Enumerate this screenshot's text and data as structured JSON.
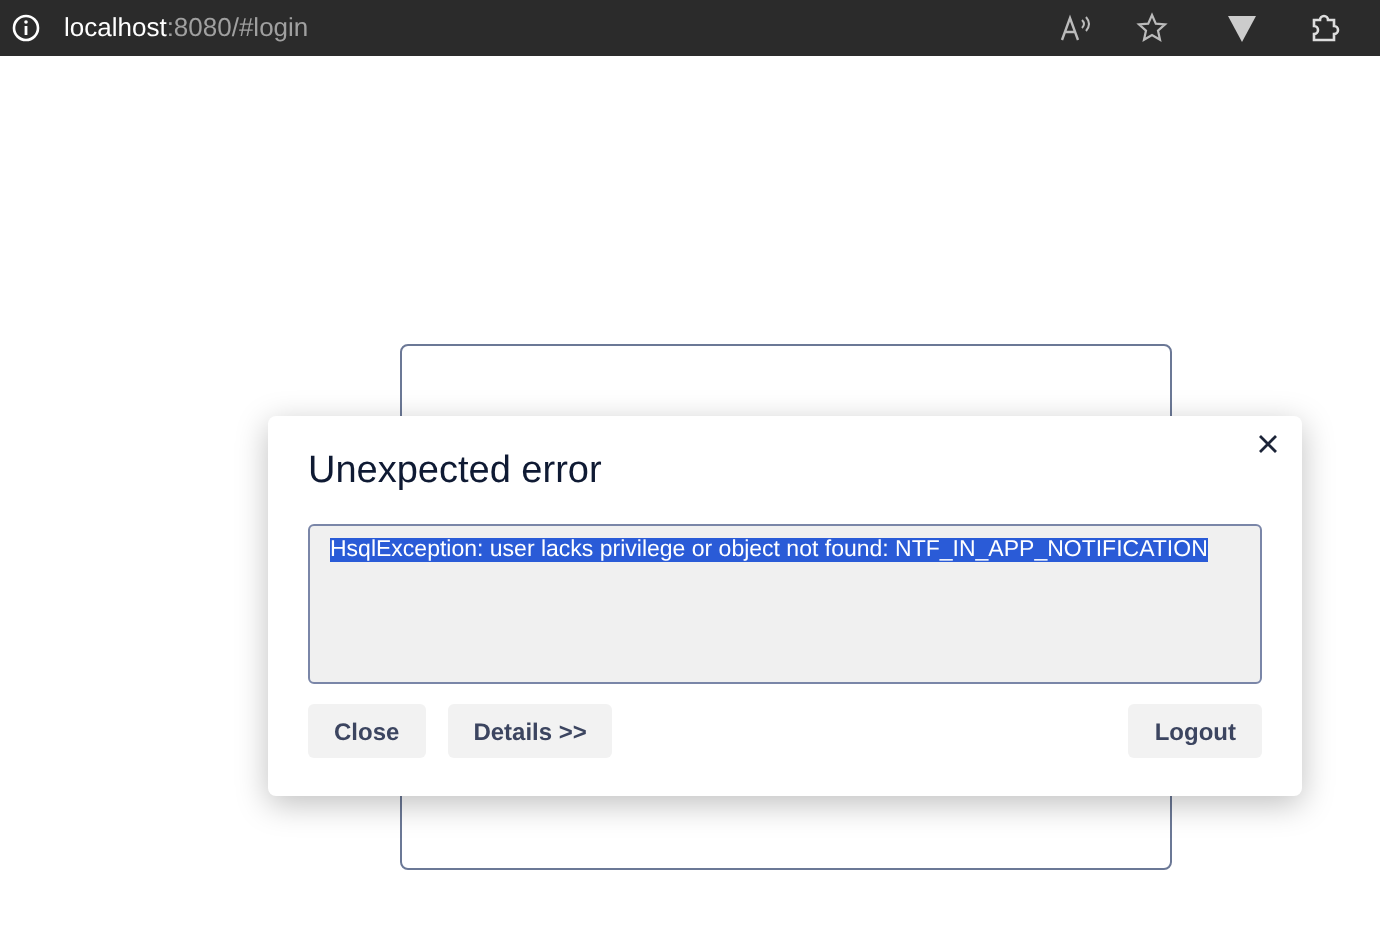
{
  "browser": {
    "address_host": "localhost",
    "address_rest": ":8080/#login"
  },
  "dialog": {
    "title": "Unexpected error",
    "message": {
      "text": "HsqlException: user lacks privilege or object not found: NTF_IN_APP_NOTIFICATION",
      "selected": true
    },
    "buttons_left": [
      {
        "label": "Close"
      },
      {
        "label": "Details >>"
      }
    ],
    "buttons_right": [
      {
        "label": "Logout"
      }
    ]
  }
}
